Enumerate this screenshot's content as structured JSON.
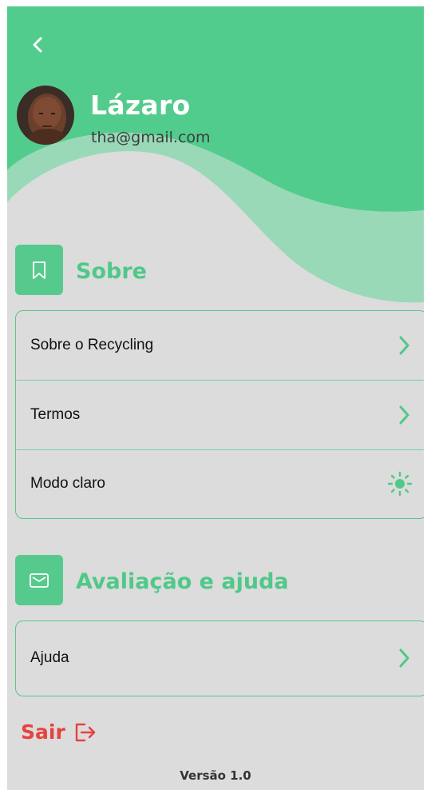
{
  "profile": {
    "name": "Lázaro",
    "email": "tha@gmail.com"
  },
  "sections": {
    "about": {
      "title": "Sobre",
      "icon": "bookmark-icon",
      "items": [
        {
          "label": "Sobre o Recycling",
          "icon": "chevron-right-icon"
        },
        {
          "label": "Termos",
          "icon": "chevron-right-icon"
        },
        {
          "label": "Modo claro",
          "icon": "sun-icon"
        }
      ]
    },
    "help": {
      "title": "Avaliação e ajuda",
      "icon": "mail-icon",
      "items": [
        {
          "label": "Ajuda",
          "icon": "chevron-right-icon"
        }
      ]
    }
  },
  "logout": {
    "label": "Sair",
    "icon": "logout-icon"
  },
  "footer": {
    "version": "Versão 1.0"
  },
  "colors": {
    "primary": "#52cc8c",
    "accent_text": "#4fc888",
    "background": "#dcdcdc",
    "danger": "#e6423e"
  }
}
